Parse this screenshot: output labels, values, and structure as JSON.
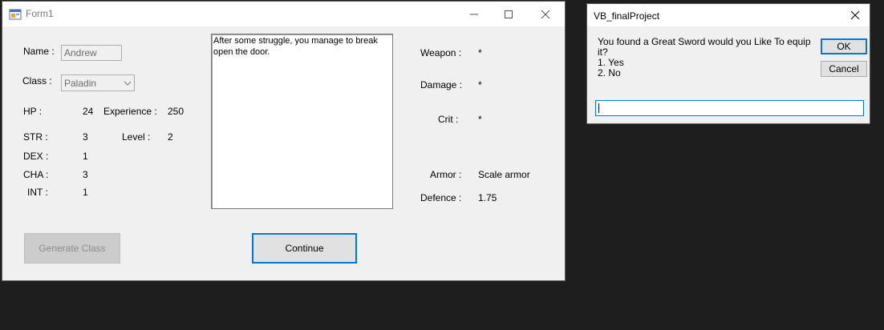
{
  "form1": {
    "title": "Form1",
    "stats": {
      "name_label": "Name :",
      "name_value": "Andrew",
      "class_label": "Class :",
      "class_value": "Paladin",
      "hp_label": "HP :",
      "hp_value": "24",
      "experience_label": "Experience :",
      "experience_value": "250",
      "str_label": "STR :",
      "str_value": "3",
      "level_label": "Level :",
      "level_value": "2",
      "dex_label": "DEX :",
      "dex_value": "1",
      "cha_label": "CHA :",
      "cha_value": "3",
      "int_label": "INT :",
      "int_value": "1"
    },
    "story_text": "After some struggle, you manage to break open the door.",
    "equipment": {
      "weapon_label": "Weapon :",
      "weapon_value": "*",
      "damage_label": "Damage :",
      "damage_value": "*",
      "crit_label": "Crit :",
      "crit_value": "*",
      "armor_label": "Armor :",
      "armor_value": "Scale armor",
      "defence_label": "Defence :",
      "defence_value": "1.75"
    },
    "buttons": {
      "generate_class": "Generate Class",
      "continue": "Continue"
    }
  },
  "dialog": {
    "title": "VB_finalProject",
    "prompt_line1": "You found a Great Sword would you Like To equip",
    "prompt_line2": "it?",
    "option1": "1. Yes",
    "option2": "2. No",
    "ok_label": "OK",
    "cancel_label": "Cancel",
    "input_value": ""
  },
  "colors": {
    "window_bg": "#f0f0f0",
    "desktop_bg": "#1e1e1e",
    "accent": "#0078d7"
  }
}
